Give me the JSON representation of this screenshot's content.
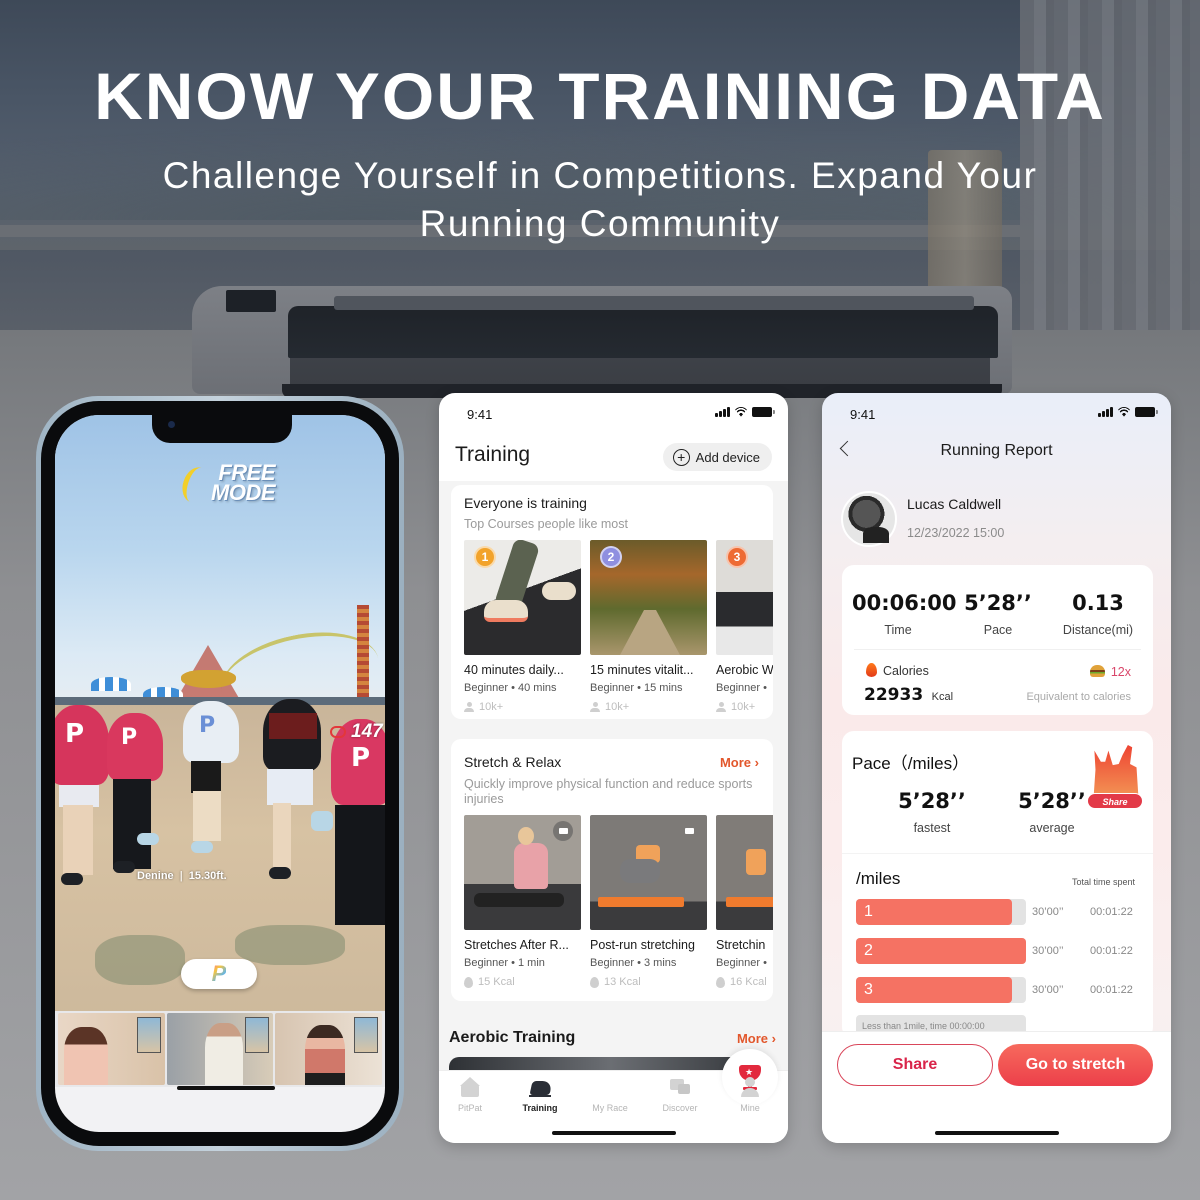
{
  "banner": {
    "headline": "KNOW YOUR TRAINING DATA",
    "subline_1": "Challenge Yourself in Competitions. Expand Your",
    "subline_2": "Running Community"
  },
  "game_phone": {
    "mode_logo_line1": "FREE",
    "mode_logo_line2": "MODE",
    "heart_rate": "147",
    "runner_name": "Denine",
    "runner_distance": "15.30ft.",
    "center_button_icon": "pitpat-logo-icon",
    "video_thumbnails": [
      "user-running-video-1",
      "user-running-video-2",
      "user-running-video-3"
    ]
  },
  "training_app": {
    "status_time": "9:41",
    "title": "Training",
    "add_device_label": "Add device",
    "popular": {
      "title": "Everyone is training",
      "subtitle": "Top Courses people like most",
      "courses": [
        {
          "rank": "1",
          "name": "40 minutes daily...",
          "meta": "Beginner • 40 mins",
          "stat": "10k+"
        },
        {
          "rank": "2",
          "name": "15 minutes vitalit...",
          "meta": "Beginner • 15 mins",
          "stat": "10k+"
        },
        {
          "rank": "3",
          "name": "Aerobic W",
          "meta": "Beginner •",
          "stat": "10k+"
        }
      ]
    },
    "stretch": {
      "title": "Stretch & Relax",
      "more_label": "More",
      "subtitle": "Quickly improve physical function and reduce sports injuries",
      "courses": [
        {
          "name": "Stretches After R...",
          "meta": "Beginner • 1 min",
          "stat": "15 Kcal"
        },
        {
          "name": "Post-run stretching",
          "meta": "Beginner • 3 mins",
          "stat": "13 Kcal"
        },
        {
          "name": "Stretchin",
          "meta": "Beginner •",
          "stat": "16 Kcal"
        }
      ]
    },
    "aerobic": {
      "title": "Aerobic Training",
      "more_label": "More"
    },
    "tabs": [
      {
        "label": "PitPat",
        "icon": "home-icon",
        "active": false
      },
      {
        "label": "Training",
        "icon": "sneaker-icon",
        "active": true
      },
      {
        "label": "My Race",
        "icon": "trophy-icon",
        "active": false
      },
      {
        "label": "Discover",
        "icon": "chat-bubbles-icon",
        "active": false
      },
      {
        "label": "Mine",
        "icon": "person-icon",
        "active": false
      }
    ]
  },
  "report_app": {
    "status_time": "9:41",
    "title": "Running Report",
    "user_name": "Lucas Caldwell",
    "date": "12/23/2022 15:00",
    "summary": {
      "time_value": "00:06:00",
      "time_label": "Time",
      "pace_value": "5’28’’",
      "pace_label": "Pace",
      "distance_value": "0.13",
      "distance_label": "Distance(mi)",
      "calories_label": "Calories",
      "calories_value": "22933",
      "calories_unit": "Kcal",
      "equivalent_value": "12x",
      "equivalent_label": "Equivalent to calories"
    },
    "pace": {
      "title": "Pace（/miles）",
      "fastest_value": "5’28’’",
      "fastest_label": "fastest",
      "average_value": "5’28’’",
      "average_label": "average",
      "share_badge": "Share"
    },
    "splits": {
      "title": "/miles",
      "total_label": "Total time spent",
      "rows": [
        {
          "index": "1",
          "pace": "30’00’’",
          "time": "00:01:22",
          "fill": 0.92
        },
        {
          "index": "2",
          "pace": "30’00’’",
          "time": "00:01:22",
          "fill": 1.0
        },
        {
          "index": "3",
          "pace": "30’00’’",
          "time": "00:01:22",
          "fill": 0.92
        }
      ],
      "remainder_label": "Less than 1mile, time 00:00:00"
    },
    "share_button": "Share",
    "stretch_button": "Go to stretch",
    "colors": {
      "accent": "#f57263",
      "button_red": "#ec3f4a",
      "more_orange": "#e2572c"
    }
  }
}
